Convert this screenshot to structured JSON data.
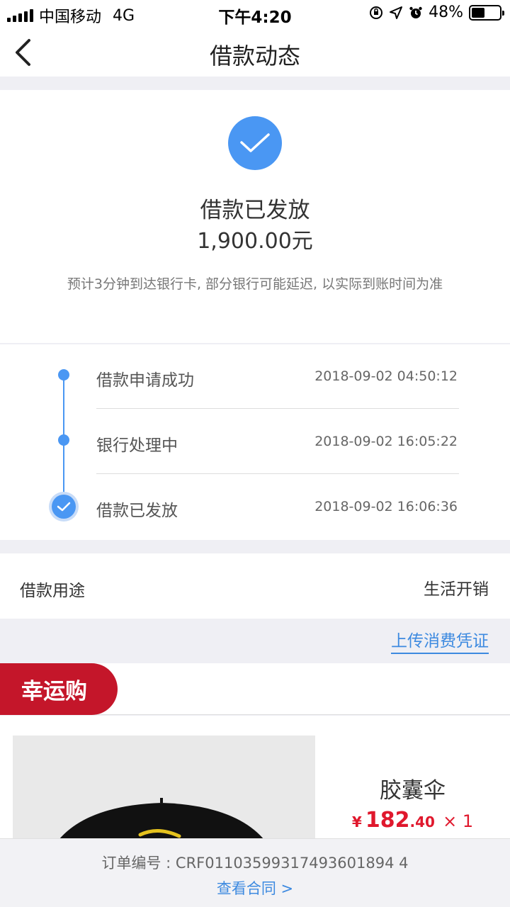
{
  "status_bar": {
    "carrier": "中国移动",
    "network": "4G",
    "time": "下午4:20",
    "battery": "48%",
    "battery_level": 0.48
  },
  "nav": {
    "title": "借款动态",
    "back_icon": "chevron-left-icon"
  },
  "status_card": {
    "title": "借款已发放",
    "amount": "1,900.00元",
    "note": "预计3分钟到达银行卡, 部分银行可能延迟, 以实际到账时间为准",
    "icon": "check-circle-icon",
    "accent_color": "#4a97f3"
  },
  "timeline": [
    {
      "label": "借款申请成功",
      "time": "2018-09-02 04:50:12"
    },
    {
      "label": "银行处理中",
      "time": "2018-09-02 16:05:22"
    },
    {
      "label": "借款已发放",
      "time": "2018-09-02 16:06:36"
    }
  ],
  "purpose": {
    "label": "借款用途",
    "value": "生活开销"
  },
  "upload_link": "上传消费凭证",
  "lucky": {
    "badge": "幸运购",
    "badge_color": "#c4162a"
  },
  "product": {
    "name": "胶囊伞",
    "price_symbol": "¥",
    "price_integer": "182",
    "price_decimal": ".40",
    "quantity": "× 1",
    "price_color": "#e0182d"
  },
  "footer": {
    "order_number": "订单编号 : CRF01103599317493601894 4",
    "contract_link": "查看合同 >"
  }
}
